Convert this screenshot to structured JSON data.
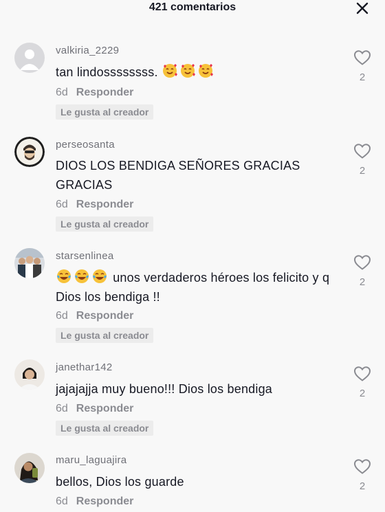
{
  "header": {
    "title": "421 comentarios"
  },
  "icons": {
    "close": "close-icon",
    "like": "heart-outline-icon"
  },
  "colors": {
    "text": "#161823",
    "muted": "#8a8b91",
    "badge_bg": "#ececec",
    "background": "#f8f8f8"
  },
  "comments": [
    {
      "username": "valkiria_2229",
      "text": "tan lindossssssss.",
      "emojis": [
        "smiling-face-with-hearts",
        "smiling-face-with-hearts",
        "smiling-face-with-hearts"
      ],
      "age": "6d",
      "reply": "Responder",
      "badge": "Le gusta al creador",
      "likes": "2"
    },
    {
      "username": "perseosanta",
      "text": "DIOS LOS BENDIGA SEÑORES GRACIAS GRACIAS",
      "age": "6d",
      "reply": "Responder",
      "badge": "Le gusta al creador",
      "likes": "2"
    },
    {
      "username": "starsenlinea",
      "emojis": [
        "face-with-tears-of-joy",
        "face-with-tears-of-joy",
        "face-with-tears-of-joy"
      ],
      "text": "unos verdaderos héroes los felicito y q Dios los bendiga !!",
      "age": "6d",
      "reply": "Responder",
      "badge": "Le gusta al creador",
      "likes": "2"
    },
    {
      "username": "janethar142",
      "text": "jajajajja muy bueno!!! Dios los bendiga",
      "age": "6d",
      "reply": "Responder",
      "badge": "Le gusta al creador",
      "likes": "2"
    },
    {
      "username": "maru_laguajira",
      "text": "bellos, Dios los guarde",
      "age": "6d",
      "reply": "Responder",
      "likes": "2"
    }
  ]
}
